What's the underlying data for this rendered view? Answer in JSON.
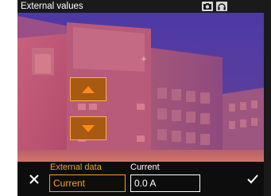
{
  "window": {
    "title": "External values"
  },
  "toolbar": {
    "icons": [
      "camera-icon",
      "headset-icon"
    ]
  },
  "controls": {
    "up_icon": "arrow-up-icon",
    "down_icon": "arrow-down-icon",
    "close_icon": "close-icon",
    "confirm_icon": "checkmark-icon"
  },
  "external_data": {
    "label": "External data",
    "value": "Current"
  },
  "current": {
    "label": "Current",
    "value": "0.0 A"
  },
  "colors": {
    "accent": "#f5a224",
    "button_fill": "#a85a12",
    "bar_background": "#0d0d0d",
    "title_background": "#1a1a1a"
  }
}
